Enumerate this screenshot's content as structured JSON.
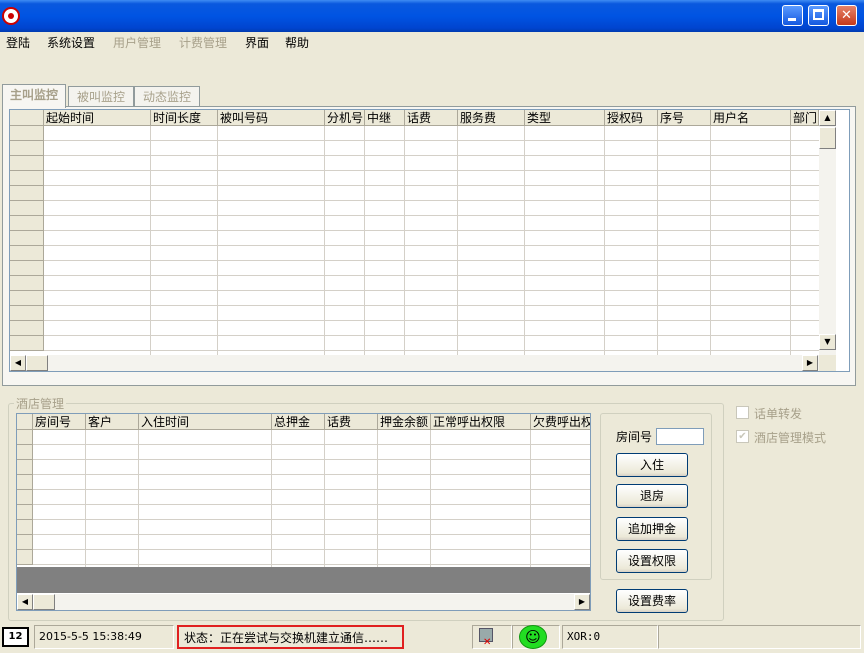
{
  "window": {
    "title": "",
    "controls": [
      "minimize",
      "maximize",
      "close"
    ],
    "icon": "app-logo-icon"
  },
  "menu": [
    {
      "label": "登陆",
      "enabled": true
    },
    {
      "label": "系统设置",
      "enabled": true
    },
    {
      "label": "用户管理",
      "enabled": false
    },
    {
      "label": "计费管理",
      "enabled": false
    },
    {
      "label": "界面",
      "enabled": true
    },
    {
      "label": "帮助",
      "enabled": true
    }
  ],
  "tabs": [
    {
      "label": "主叫监控",
      "active": true
    },
    {
      "label": "被叫监控",
      "active": false
    },
    {
      "label": "动态监控",
      "active": false
    }
  ],
  "monitor_table": {
    "columns": [
      "起始时间",
      "时间长度",
      "被叫号码",
      "分机号",
      "中继",
      "话费",
      "服务费",
      "类型",
      "授权码",
      "序号",
      "用户名",
      "部门"
    ],
    "rows": []
  },
  "hotel": {
    "group_label": "酒店管理",
    "columns": [
      "房间号",
      "客户",
      "入住时间",
      "总押金",
      "话费",
      "押金余额",
      "正常呼出权限",
      "欠费呼出权"
    ],
    "rows": [],
    "room_label": "房间号",
    "room_value": "",
    "buttons": {
      "checkin": "入住",
      "checkout": "退房",
      "add_deposit": "追加押金",
      "set_permission": "设置权限",
      "set_rate": "设置费率"
    }
  },
  "options": [
    {
      "label": "话单转发",
      "checked": false,
      "enabled": false
    },
    {
      "label": "酒店管理模式",
      "checked": true,
      "enabled": false
    }
  ],
  "status": {
    "datetime": "2015-5-5 15:38:49",
    "message": "状态：正在尝试与交换机建立通信……",
    "network_icon": "network-disconnected-icon",
    "face_icon": "smiley-face-icon",
    "xor": "XOR:0",
    "highlight_color": "#e02020"
  }
}
